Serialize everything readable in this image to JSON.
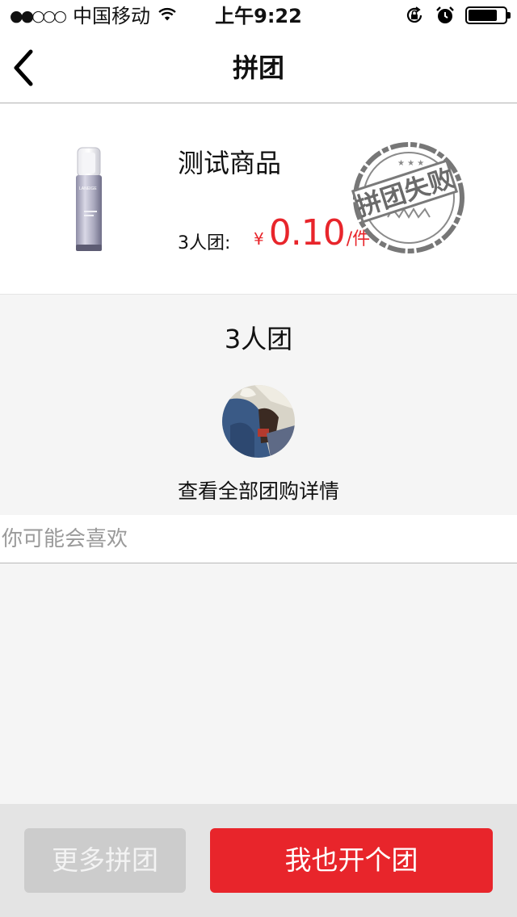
{
  "status_bar": {
    "signal": "●●○○○",
    "carrier": "中国移动",
    "time": "上午9:22",
    "battery_level": 0.8
  },
  "nav": {
    "title": "拼团",
    "back_icon": "chevron-left-icon"
  },
  "product": {
    "name": "测试商品",
    "group_label": "3人团:",
    "currency": "¥",
    "price": "0.10",
    "unit": "/件",
    "stamp_text": "拼团失败",
    "image_brand": "LANEIGE",
    "accent_color": "#e8252b"
  },
  "group": {
    "title": "3人团",
    "details_link": "查看全部团购详情"
  },
  "recommendations": {
    "title": "你可能会喜欢"
  },
  "bottom_bar": {
    "more_groups_label": "更多拼团",
    "open_group_label": "我也开个团"
  }
}
